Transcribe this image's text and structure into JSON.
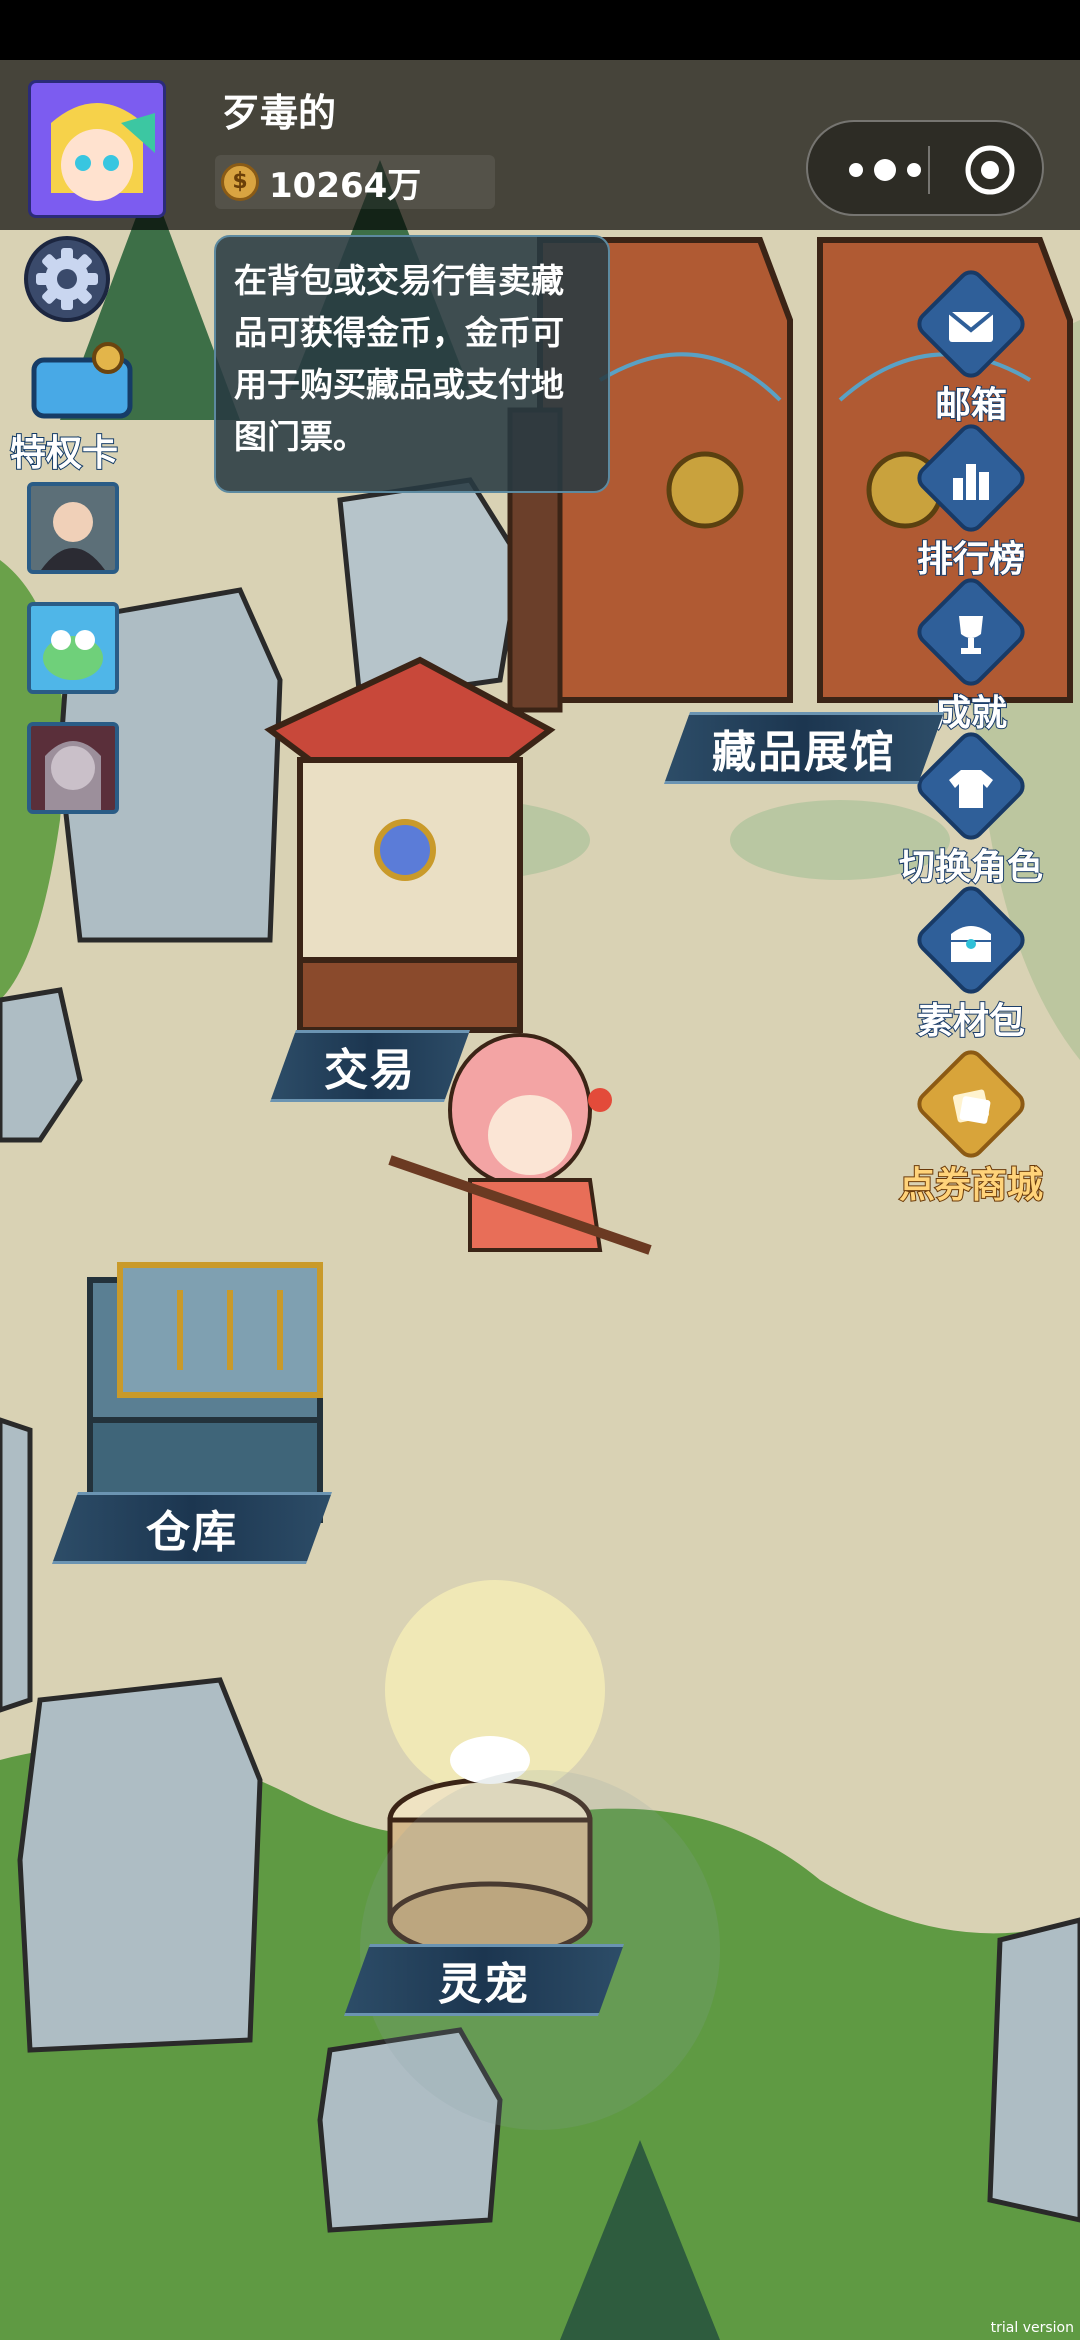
{
  "header": {
    "player_name": "歹毒的",
    "coins": "10264万"
  },
  "left_panel": {
    "privilege_label": "特权卡"
  },
  "tip": {
    "text": "在背包或交易行售卖藏品可获得金币，金币可用于购买藏品或支付地图门票。"
  },
  "right_menu": [
    {
      "label": "邮箱",
      "icon": "mail-icon"
    },
    {
      "label": "排行榜",
      "icon": "bar-chart-icon"
    },
    {
      "label": "成就",
      "icon": "trophy-icon"
    },
    {
      "label": "切换角色",
      "icon": "shirt-icon"
    },
    {
      "label": "素材包",
      "icon": "treasure-chest-icon"
    },
    {
      "label": "点券商城",
      "icon": "coupon-icon"
    }
  ],
  "map_labels": {
    "gallery": "藏品展馆",
    "trade": "交易",
    "warehouse": "仓库",
    "pet": "灵宠"
  },
  "watermark": "trial version",
  "colors": {
    "ground": "#d9d2b4",
    "grass": "#5f9a43",
    "label_bg": "#1c3650",
    "menu_blue": "#2f5f99",
    "menu_gold": "#d8a43a"
  }
}
